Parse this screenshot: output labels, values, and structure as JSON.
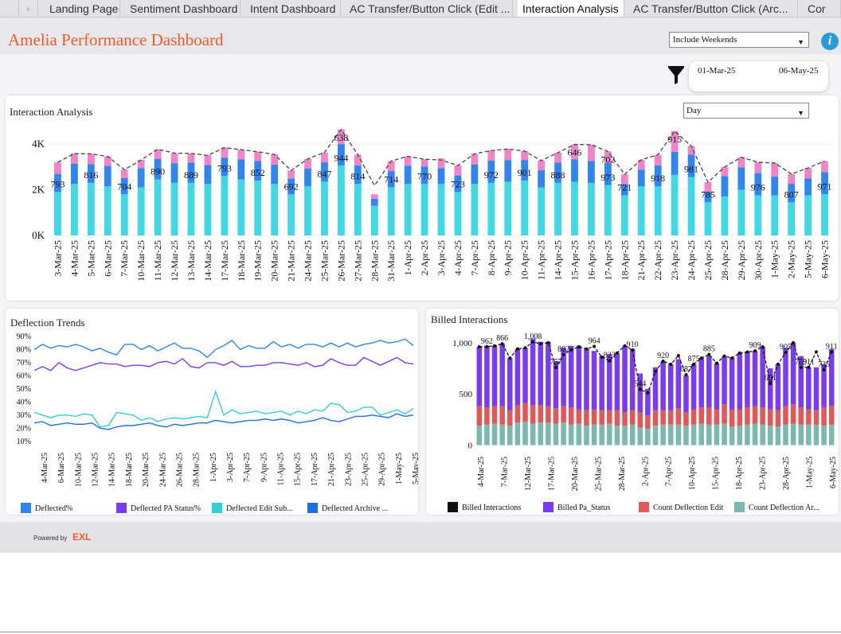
{
  "tabs": [
    {
      "label": "Landing Page"
    },
    {
      "label": "Sentiment Dashboard"
    },
    {
      "label": "Intent Dashboard"
    },
    {
      "label": "AC Transfer/Button Click (Edit ..."
    },
    {
      "label": "Interaction Analysis",
      "active": true
    },
    {
      "label": "AC Transfer/Button Click (Arc..."
    },
    {
      "label": "Cor"
    }
  ],
  "nav": {
    "prev_glyph": "‹"
  },
  "header": {
    "title": "Amelia Performance Dashboard",
    "weekend_option": "Include Weekends",
    "info_glyph": "i"
  },
  "filters": {
    "date_start": "01-Mar-25",
    "date_end": "06-May-25",
    "granularity": "Day"
  },
  "colors": {
    "accent": "#f05a28",
    "cyan": "#40d8e2",
    "blue": "#2f86f0",
    "pink": "#f084c8",
    "purple": "#7a3cf0",
    "red": "#e05858",
    "teal": "#7ab8b0"
  },
  "icons": {
    "info": "info-icon",
    "filter": "funnel-icon",
    "caret": "chevron-down-icon"
  },
  "interaction": {
    "title": "Interaction Analysis",
    "chart_data": {
      "type": "bar",
      "stacked": true,
      "categories": [
        "3-Mar-25",
        "4-Mar-25",
        "5-Mar-25",
        "6-Mar-25",
        "7-Mar-25",
        "10-Mar-25",
        "11-Mar-25",
        "12-Mar-25",
        "13-Mar-25",
        "14-Mar-25",
        "17-Mar-25",
        "18-Mar-25",
        "19-Mar-25",
        "20-Mar-25",
        "21-Mar-25",
        "24-Mar-25",
        "25-Mar-25",
        "26-Mar-25",
        "27-Mar-25",
        "28-Mar-25",
        "31-Mar-25",
        "1-Apr-25",
        "2-Apr-25",
        "3-Apr-25",
        "4-Apr-25",
        "7-Apr-25",
        "8-Apr-25",
        "9-Apr-25",
        "10-Apr-25",
        "11-Apr-25",
        "14-Apr-25",
        "15-Apr-25",
        "16-Apr-25",
        "17-Apr-25",
        "18-Apr-25",
        "21-Apr-25",
        "22-Apr-25",
        "23-Apr-25",
        "24-Apr-25",
        "25-Apr-25",
        "28-Apr-25",
        "29-Apr-25",
        "30-Apr-25",
        "1-May-25",
        "2-May-25",
        "5-May-25",
        "6-May-25"
      ],
      "series": [
        {
          "values": [
            1900,
            2250,
            2300,
            2150,
            1800,
            2100,
            2450,
            2300,
            2300,
            2250,
            2600,
            2450,
            2400,
            2250,
            1800,
            2150,
            2350,
            3050,
            2250,
            1300,
            2100,
            2250,
            2250,
            2250,
            1900,
            2250,
            2300,
            2350,
            2400,
            2100,
            2300,
            2350,
            2300,
            2200,
            1750,
            2150,
            2150,
            2650,
            2550,
            1450,
            1700,
            2000,
            1750,
            1750,
            1450,
            1750,
            1800
          ]
        },
        {
          "values": [
            793,
            890,
            816,
            900,
            704,
            850,
            890,
            860,
            889,
            830,
            793,
            880,
            852,
            850,
            692,
            780,
            847,
            944,
            814,
            300,
            714,
            800,
            770,
            700,
            723,
            860,
            972,
            950,
            901,
            750,
            888,
            980,
            950,
            973,
            500,
            730,
            918,
            1000,
            981,
            450,
            900,
            980,
            976,
            820,
            807,
            750,
            971
          ]
        },
        {
          "values": [
            500,
            440,
            450,
            400,
            380,
            350,
            420,
            430,
            400,
            430,
            450,
            420,
            410,
            440,
            350,
            420,
            430,
            638,
            470,
            200,
            440,
            410,
            310,
            420,
            440,
            460,
            440,
            480,
            390,
            420,
            430,
            646,
            720,
            500,
            420,
            430,
            460,
            915,
            380,
            430,
            400,
            440,
            470,
            600,
            430,
            450,
            480
          ]
        }
      ],
      "totals": [
        3200,
        3580,
        3570,
        3450,
        2880,
        3300,
        3770,
        3600,
        3590,
        3500,
        3840,
        3750,
        3660,
        3540,
        2840,
        3350,
        3630,
        4630,
        3530,
        2180,
        3250,
        3460,
        3330,
        3300,
        3060,
        3570,
        3710,
        3780,
        3690,
        3270,
        3620,
        3980,
        3970,
        3670,
        2670,
        3310,
        3530,
        4560,
        3910,
        2330,
        3000,
        3420,
        3200,
        3170,
        2690,
        2950,
        3250
      ],
      "data_labels": [
        {
          "i": 0,
          "text": "793"
        },
        {
          "i": 2,
          "text": "816"
        },
        {
          "i": 4,
          "text": "704"
        },
        {
          "i": 6,
          "text": "890"
        },
        {
          "i": 8,
          "text": "889"
        },
        {
          "i": 10,
          "text": "793"
        },
        {
          "i": 12,
          "text": "852"
        },
        {
          "i": 14,
          "text": "692"
        },
        {
          "i": 16,
          "text": "847"
        },
        {
          "i": 17,
          "text": "944"
        },
        {
          "i": 17,
          "text": "638",
          "top": true
        },
        {
          "i": 18,
          "text": "814"
        },
        {
          "i": 20,
          "text": "714"
        },
        {
          "i": 22,
          "text": "770"
        },
        {
          "i": 24,
          "text": "723"
        },
        {
          "i": 26,
          "text": "972"
        },
        {
          "i": 28,
          "text": "901"
        },
        {
          "i": 30,
          "text": "888"
        },
        {
          "i": 31,
          "text": "646",
          "top": true
        },
        {
          "i": 33,
          "text": "702",
          "top": true
        },
        {
          "i": 33,
          "text": "973"
        },
        {
          "i": 34,
          "text": "721"
        },
        {
          "i": 36,
          "text": "918"
        },
        {
          "i": 37,
          "text": "915",
          "top": true
        },
        {
          "i": 38,
          "text": "981"
        },
        {
          "i": 39,
          "text": "785"
        },
        {
          "i": 42,
          "text": "976"
        },
        {
          "i": 44,
          "text": "807"
        },
        {
          "i": 46,
          "text": "971"
        }
      ],
      "ylim": [
        0,
        4800
      ],
      "yticks": [
        {
          "v": 0,
          "label": "0K"
        },
        {
          "v": 2000,
          "label": "2K"
        },
        {
          "v": 4000,
          "label": "4K"
        }
      ],
      "grid": true
    }
  },
  "deflection": {
    "title": "Deflection Trends",
    "chart_data": {
      "type": "line",
      "x_labels": [
        "4-Mar-25",
        "6-Mar-25",
        "10-Mar-25",
        "12-Mar-25",
        "14-Mar-25",
        "18-Mar-25",
        "20-Mar-25",
        "24-Mar-25",
        "26-Mar-25",
        "28-Mar-25",
        "1-Apr-25",
        "3-Apr-25",
        "7-Apr-25",
        "9-Apr-25",
        "11-Apr-25",
        "15-Apr-25",
        "17-Apr-25",
        "21-Apr-25",
        "23-Apr-25",
        "25-Apr-25",
        "29-Apr-25",
        "1-May-25",
        "5-May-25"
      ],
      "yticks": [
        "10%",
        "20%",
        "30%",
        "40%",
        "50%",
        "60%",
        "70%",
        "80%",
        "90%"
      ],
      "ylim": [
        5,
        93
      ],
      "series": [
        {
          "name": "Deflected%",
          "color": "#2f86f0",
          "values": [
            80,
            84,
            81,
            83,
            82,
            84,
            82,
            79,
            81,
            78,
            76,
            84,
            84,
            80,
            83,
            79,
            82,
            85,
            81,
            81,
            79,
            74,
            80,
            83,
            87,
            80,
            83,
            81,
            81,
            86,
            82,
            84,
            81,
            84,
            84,
            82,
            85,
            82,
            85,
            82,
            84,
            85,
            87,
            85,
            86,
            88,
            83
          ]
        },
        {
          "name": "Deflected PA Status%",
          "color": "#7a3cf0",
          "values": [
            64,
            67,
            64,
            70,
            66,
            64,
            66,
            68,
            70,
            69,
            69,
            67,
            68,
            68,
            67,
            70,
            71,
            69,
            73,
            67,
            66,
            70,
            70,
            68,
            71,
            67,
            67,
            68,
            68,
            70,
            70,
            69,
            68,
            70,
            67,
            68,
            73,
            70,
            68,
            68,
            74,
            71,
            68,
            71,
            74,
            70,
            69
          ]
        },
        {
          "name": "Deflected Edit Sub...",
          "color": "#30d0d8",
          "values": [
            32,
            30,
            28,
            30,
            30,
            29,
            31,
            30,
            21,
            22,
            32,
            31,
            30,
            26,
            28,
            25,
            27,
            28,
            27,
            28,
            29,
            28,
            48,
            30,
            34,
            31,
            32,
            33,
            31,
            32,
            33,
            30,
            33,
            31,
            34,
            33,
            39,
            38,
            32,
            33,
            36,
            36,
            30,
            32,
            34,
            31,
            35
          ]
        },
        {
          "name": "Deflected Archive ...",
          "color": "#1f6fe0",
          "values": [
            24,
            25,
            22,
            23,
            24,
            23,
            23,
            24,
            20,
            19,
            21,
            22,
            22,
            23,
            24,
            22,
            21,
            23,
            22,
            23,
            24,
            24,
            26,
            25,
            24,
            25,
            26,
            26,
            27,
            26,
            27,
            26,
            24,
            25,
            26,
            28,
            26,
            25,
            27,
            29,
            29,
            30,
            29,
            28,
            31,
            29,
            30
          ]
        }
      ]
    }
  },
  "billed": {
    "title": "Billed Interactions",
    "chart_data": {
      "type": "bar",
      "stacked": true,
      "x_labels": [
        "4-Mar-25",
        "7-Mar-25",
        "12-Mar-25",
        "17-Mar-25",
        "20-Mar-25",
        "25-Mar-25",
        "28-Mar-25",
        "2-Apr-25",
        "7-Apr-25",
        "10-Apr-25",
        "15-Apr-25",
        "18-Apr-25",
        "23-Apr-25",
        "28-Apr-25",
        "1-May-25",
        "6-May-25"
      ],
      "yticks": [
        {
          "v": 0,
          "label": "0"
        },
        {
          "v": 500,
          "label": "500"
        },
        {
          "v": 1000,
          "label": "1,000"
        }
      ],
      "ylim": [
        -50,
        1100
      ],
      "series": [
        {
          "name": "Count Deflection Ar...",
          "color": "#7ab8b0",
          "values": [
            190,
            200,
            210,
            200,
            190,
            220,
            230,
            210,
            220,
            220,
            210,
            220,
            200,
            210,
            190,
            200,
            200,
            210,
            190,
            190,
            200,
            170,
            160,
            190,
            200,
            200,
            200,
            190,
            200,
            210,
            200,
            200,
            210,
            180,
            190,
            200,
            210,
            200,
            190,
            180,
            200,
            210,
            200,
            200,
            200,
            190,
            200
          ]
        },
        {
          "name": "Count Deflection Edit",
          "color": "#e05858",
          "values": [
            190,
            170,
            170,
            180,
            150,
            170,
            180,
            180,
            170,
            160,
            150,
            160,
            170,
            140,
            150,
            150,
            140,
            130,
            150,
            130,
            140,
            150,
            130,
            150,
            140,
            140,
            160,
            130,
            150,
            160,
            170,
            150,
            190,
            170,
            160,
            170,
            170,
            170,
            160,
            160,
            180,
            190,
            170,
            150,
            140,
            180,
            180
          ]
        },
        {
          "name": "Billed Pa_Status",
          "color": "#7a3cf0",
          "values": [
            580,
            600,
            590,
            610,
            510,
            550,
            540,
            650,
            620,
            630,
            460,
            570,
            600,
            620,
            600,
            570,
            530,
            550,
            560,
            650,
            600,
            380,
            260,
            420,
            480,
            450,
            480,
            360,
            440,
            480,
            500,
            450,
            470,
            500,
            550,
            540,
            540,
            590,
            400,
            450,
            570,
            600,
            500,
            410,
            420,
            420,
            560
          ]
        }
      ],
      "line": {
        "name": "Billed Interactions",
        "color": "#111111",
        "values": [
          960,
          962,
          970,
          990,
          850,
          940,
          950,
          1008,
          990,
          1000,
          757,
          882,
          930,
          960,
          940,
          964,
          860,
          823,
          900,
          970,
          930,
          544,
          510,
          720,
          820,
          790,
          875,
          687,
          790,
          850,
          885,
          800,
          870,
          850,
          900,
          910,
          920,
          960,
          601,
          790,
          905,
          1000,
          759,
          760,
          911,
          735,
          911
        ]
      },
      "point_labels": [
        {
          "i": 1,
          "text": "962"
        },
        {
          "i": 3,
          "text": "866"
        },
        {
          "i": 7,
          "text": "1,008"
        },
        {
          "i": 10,
          "text": "757"
        },
        {
          "i": 11,
          "text": "882"
        },
        {
          "i": 15,
          "text": "964"
        },
        {
          "i": 17,
          "text": "823"
        },
        {
          "i": 20,
          "text": "910"
        },
        {
          "i": 21,
          "text": "544"
        },
        {
          "i": 24,
          "text": "920"
        },
        {
          "i": 27,
          "text": "687"
        },
        {
          "i": 28,
          "text": "875"
        },
        {
          "i": 30,
          "text": "885"
        },
        {
          "i": 36,
          "text": "909"
        },
        {
          "i": 38,
          "text": "601"
        },
        {
          "i": 40,
          "text": "905"
        },
        {
          "i": 42,
          "text": "759"
        },
        {
          "i": 43,
          "text": "911"
        },
        {
          "i": 45,
          "text": "735"
        },
        {
          "i": 46,
          "text": "911"
        }
      ]
    }
  },
  "footer": {
    "powered_by": "Powered by",
    "brand": "EXL"
  }
}
